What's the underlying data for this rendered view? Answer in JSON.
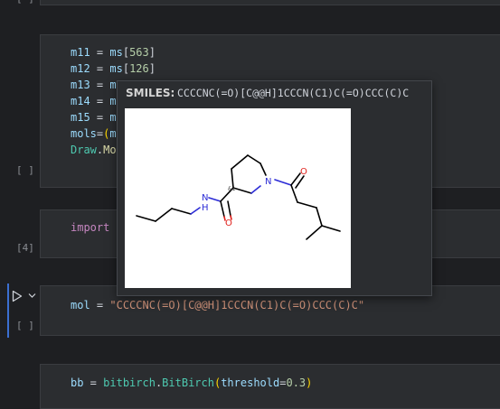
{
  "cells": {
    "top_fold_label": "[ ]",
    "cell2": {
      "prompt": "[ ]",
      "lines": {
        "m11_var": "m11",
        "m11_eq": " = ",
        "m11_arr": "ms",
        "m11_lb": "[",
        "m11_idx": "563",
        "m11_rb": "]",
        "m12_var": "m12",
        "m12_eq": " = ",
        "m12_arr": "ms",
        "m12_lb": "[",
        "m12_idx": "126",
        "m12_rb": "]",
        "m13_var": "m13",
        "m13_eq": " = ",
        "m13_arr": "m",
        "m14_var": "m14",
        "m14_eq": " = ",
        "m14_arr": "m",
        "m15_var": "m15",
        "m15_eq": " = ",
        "m15_arr": "m",
        "mols_var": "mols",
        "mols_eq": "=",
        "mols_paren": "(",
        "mols_rest": "m",
        "draw_var": "Draw",
        "draw_dot": ".",
        "draw_fn": "Mo"
      }
    },
    "cell3": {
      "prompt": "[4]",
      "keyword": "import"
    },
    "cell4": {
      "prompt": "[ ]",
      "var": "mol",
      "eq": " = ",
      "value": "\"CCCCNC(=O)[C@@H]1CCCN(C1)C(=O)CCC(C)C\""
    },
    "cell5": {
      "var": "bb",
      "eq": " = ",
      "module": "bitbirch",
      "dot": ".",
      "cls": "BitBirch",
      "lparen": "(",
      "kw": "threshold",
      "kweq": "=",
      "num": "0.3",
      "rparen": ")"
    }
  },
  "tooltip": {
    "label": "SMILES:",
    "smiles": "CCCCNC(=O)[C@@H]1CCCN(C1)C(=O)CCC(C)C",
    "atoms": {
      "N1": "N",
      "H1": "H",
      "O1": "O",
      "N2": "N",
      "O2": "O",
      "stereo": "&1"
    }
  },
  "colors": {
    "nitrogen": "#2c2cd6",
    "oxygen": "#e0201b",
    "bond": "#000000",
    "run_bar": "#3b6fd1"
  },
  "icons": {
    "run": "run-triangle-icon",
    "chevron": "chevron-down-icon"
  }
}
